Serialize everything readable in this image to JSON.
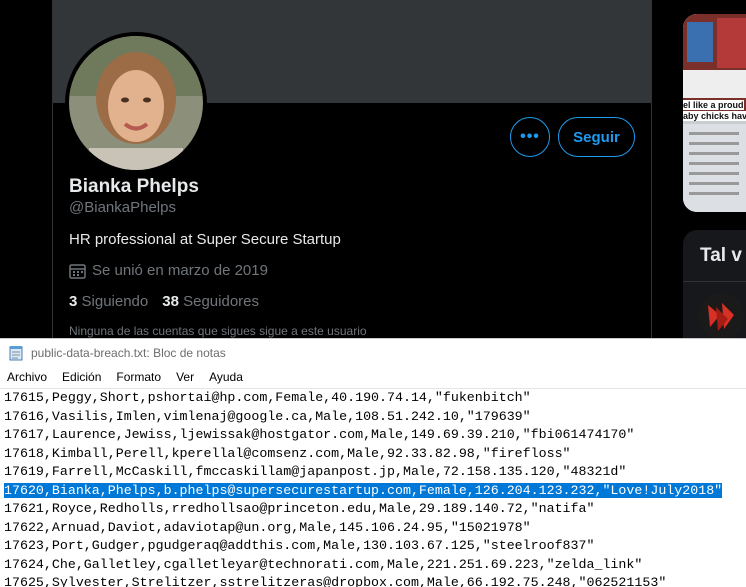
{
  "profile": {
    "name": "Bianka Phelps",
    "handle": "@BiankaPhelps",
    "bio": "HR professional at Super Secure Startup",
    "joined": "Se unió en marzo de 2019",
    "following_count": "3",
    "following_label": "Siguiendo",
    "followers_count": "38",
    "followers_label": "Seguidores",
    "note": "Ninguna de las cuentas que sigues sigue a este usuario",
    "more_label": "•••",
    "follow_label": "Seguir",
    "accent_color": "#1d9bf0"
  },
  "sidebar": {
    "card_title": "Tal v",
    "image_caption_1": "el like a proud",
    "image_caption_2": "aby chicks have"
  },
  "notepad": {
    "title": "public-data-breach.txt: Bloc de notas",
    "menu": [
      "Archivo",
      "Edición",
      "Formato",
      "Ver",
      "Ayuda"
    ],
    "lines": [
      "17615,Peggy,Short,pshortai@hp.com,Female,40.190.74.14,\"fukenbitch\"",
      "17616,Vasilis,Imlen,vimlenaj@google.ca,Male,108.51.242.10,\"179639\"",
      "17617,Laurence,Jewiss,ljewissak@hostgator.com,Male,149.69.39.210,\"fbi061474170\"",
      "17618,Kimball,Perell,kperellal@comsenz.com,Male,92.33.82.98,\"firefloss\"",
      "17619,Farrell,McCaskill,fmccaskillam@japanpost.jp,Male,72.158.135.120,\"48321d\"",
      "17620,Bianka,Phelps,b.phelps@supersecurestartup.com,Female,126.204.123.232,\"Love!July2018\"",
      "17621,Royce,Redholls,rredhollsao@princeton.edu,Male,29.189.140.72,\"natifa\"",
      "17622,Arnuad,Daviot,adaviotap@un.org,Male,145.106.24.95,\"15021978\"",
      "17623,Port,Gudger,pgudgeraq@addthis.com,Male,130.103.67.125,\"steelroof837\"",
      "17624,Che,Galletley,cgalletleyar@technorati.com,Male,221.251.69.223,\"zelda_link\"",
      "17625,Sylvester,Strelitzer,sstrelitzeras@dropbox.com,Male,66.192.75.248,\"062521153\""
    ],
    "selected_line": 5,
    "selection_color": "#0078d7"
  }
}
